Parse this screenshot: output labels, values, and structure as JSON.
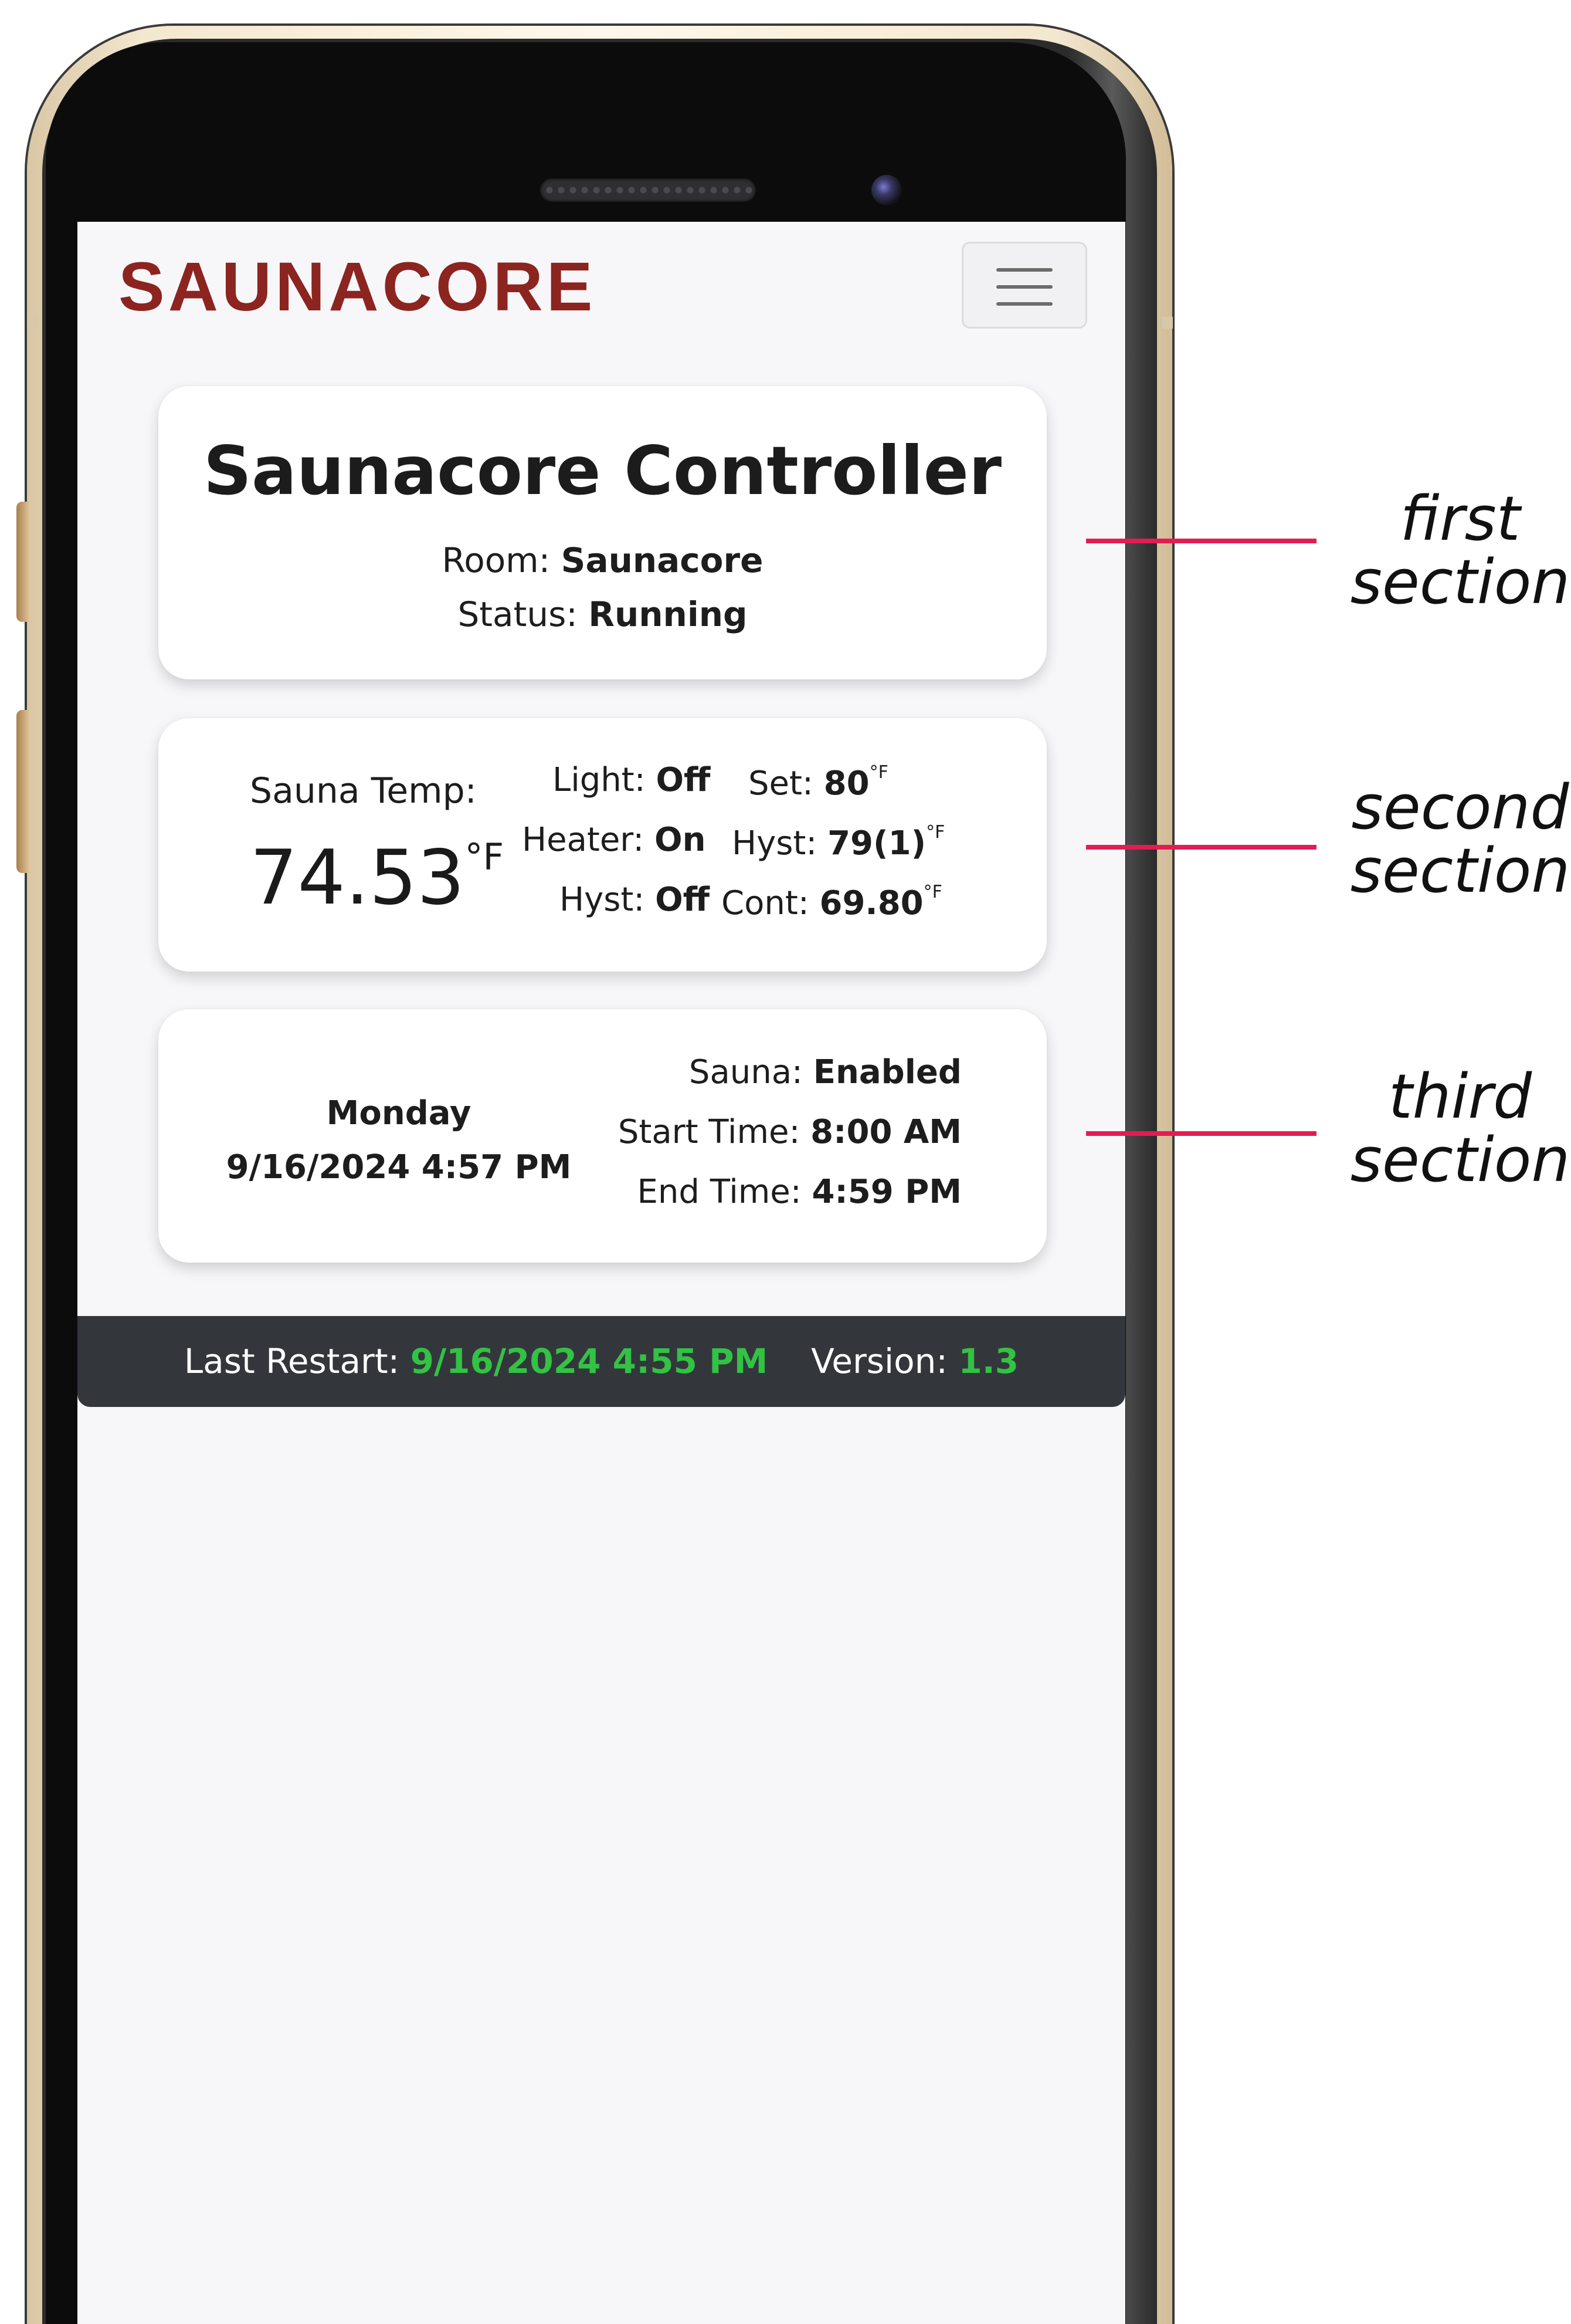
{
  "brand": "SAUNACORE",
  "header": {
    "menu_icon": "hamburger-icon"
  },
  "first_section": {
    "title": "Saunacore Controller",
    "room_label": "Room:",
    "room_value": "Saunacore",
    "status_label": "Status:",
    "status_value": "Running"
  },
  "second_section": {
    "temp_label": "Sauna Temp:",
    "temp_value": "74.53",
    "temp_unit": "°F",
    "light_label": "Light:",
    "light_value": "Off",
    "set_label": "Set:",
    "set_value": "80",
    "set_unit": "°F",
    "heater_label": "Heater:",
    "heater_value": "On",
    "hyst_label": "Hyst:",
    "hyst_value": "79(1)",
    "hyst_unit": "°F",
    "hyst2_label": "Hyst:",
    "hyst2_value": "Off",
    "cont_label": "Cont:",
    "cont_value": "69.80",
    "cont_unit": "°F"
  },
  "third_section": {
    "day": "Monday",
    "datetime": "9/16/2024 4:57 PM",
    "sauna_label": "Sauna:",
    "sauna_value": "Enabled",
    "start_label": "Start Time:",
    "start_value": "8:00 AM",
    "end_label": "End Time:",
    "end_value": "4:59 PM"
  },
  "footer": {
    "restart_label": "Last Restart:",
    "restart_value": "9/16/2024 4:55 PM",
    "version_label": "Version:",
    "version_value": "1.3"
  },
  "callouts": {
    "first": [
      "first",
      "section"
    ],
    "second": [
      "second",
      "section"
    ],
    "third": [
      "third",
      "section"
    ],
    "line_color": "#e31c53"
  },
  "colors": {
    "brand": "#8c2420",
    "footer_bg": "#33373c",
    "footer_accent": "#32c244"
  }
}
